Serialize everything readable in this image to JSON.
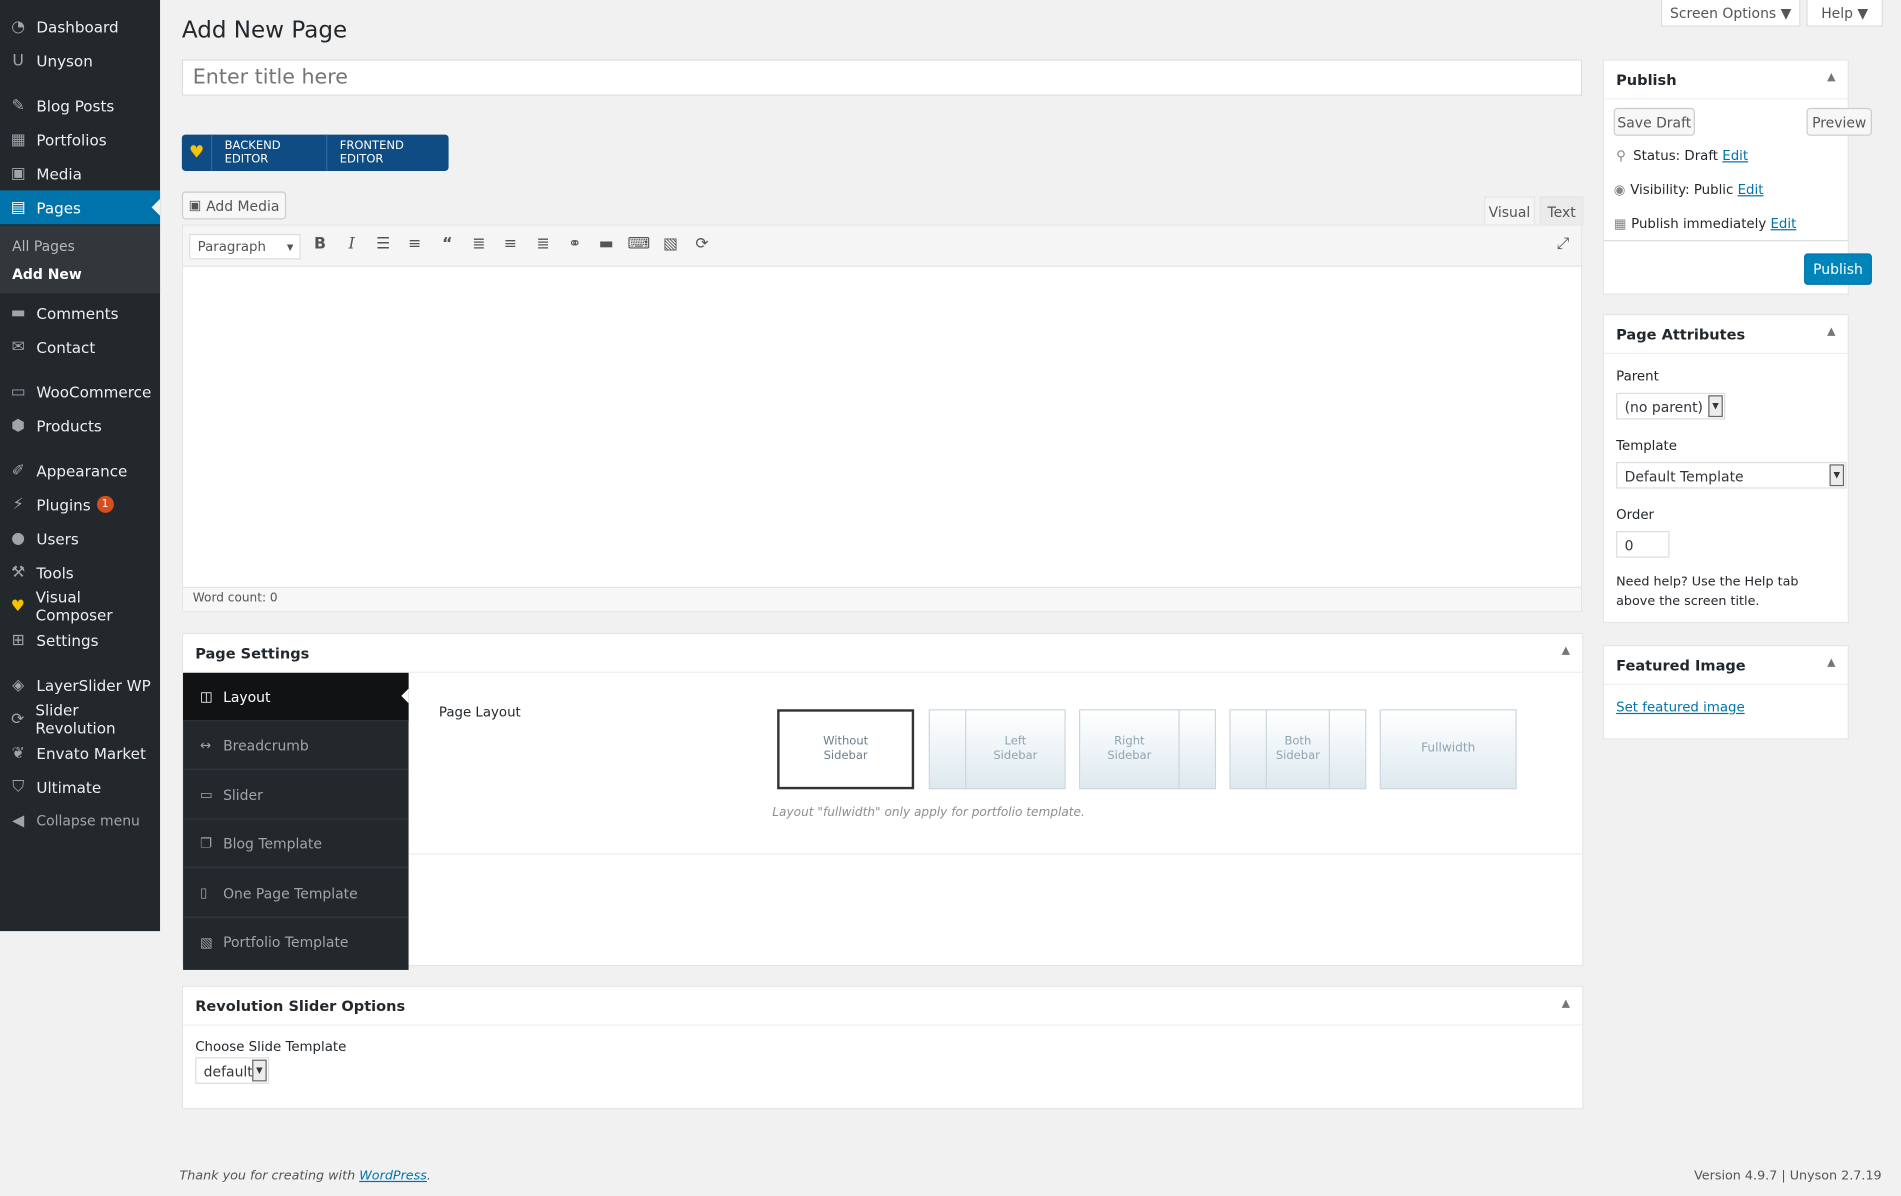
{
  "menu": {
    "items": [
      {
        "label": "Dashboard",
        "icon": "dashboard-icon",
        "glyph": "◔"
      },
      {
        "label": "Unyson",
        "icon": "unyson-icon",
        "glyph": "U"
      },
      {
        "label": "Blog Posts",
        "icon": "pin-icon",
        "glyph": "✎"
      },
      {
        "label": "Portfolios",
        "icon": "portfolio-icon",
        "glyph": "▦"
      },
      {
        "label": "Media",
        "icon": "media-icon",
        "glyph": "▣"
      },
      {
        "label": "Pages",
        "icon": "pages-icon",
        "glyph": "▤"
      },
      {
        "label": "Comments",
        "icon": "comments-icon",
        "glyph": "▬"
      },
      {
        "label": "Contact",
        "icon": "mail-icon",
        "glyph": "✉"
      },
      {
        "label": "WooCommerce",
        "icon": "woocommerce-icon",
        "glyph": "▭"
      },
      {
        "label": "Products",
        "icon": "products-icon",
        "glyph": "⬢"
      },
      {
        "label": "Appearance",
        "icon": "brush-icon",
        "glyph": "✐"
      },
      {
        "label": "Plugins",
        "icon": "plugin-icon",
        "glyph": "⚡"
      },
      {
        "label": "Users",
        "icon": "users-icon",
        "glyph": "●"
      },
      {
        "label": "Tools",
        "icon": "wrench-icon",
        "glyph": "⚒"
      },
      {
        "label": "Visual Composer",
        "icon": "visual-composer-icon",
        "glyph": "♥"
      },
      {
        "label": "Settings",
        "icon": "settings-icon",
        "glyph": "⊞"
      },
      {
        "label": "LayerSlider WP",
        "icon": "layerslider-icon",
        "glyph": "◈"
      },
      {
        "label": "Slider Revolution",
        "icon": "refresh-icon",
        "glyph": "⟳"
      },
      {
        "label": "Envato Market",
        "icon": "envato-icon",
        "glyph": "❦"
      },
      {
        "label": "Ultimate",
        "icon": "shield-icon",
        "glyph": "⛉"
      },
      {
        "label": "Collapse menu",
        "icon": "collapse-icon",
        "glyph": "◀"
      }
    ],
    "plugins_badge": "1",
    "sub": [
      "All Pages",
      "Add New"
    ]
  },
  "header": {
    "screen_options": "Screen Options ▼",
    "help": "Help ▼",
    "title": "Add New Page",
    "title_placeholder": "Enter title here"
  },
  "vc": {
    "backend": "BACKEND EDITOR",
    "frontend": "FRONTEND EDITOR"
  },
  "editor": {
    "add_media": "Add Media",
    "tab_visual": "Visual",
    "tab_text": "Text",
    "format": "Paragraph",
    "word_count": "Word count: 0"
  },
  "publish": {
    "title": "Publish",
    "save_draft": "Save Draft",
    "preview": "Preview",
    "status_label": "Status: ",
    "status": "Draft",
    "visibility_label": "Visibility: ",
    "visibility": "Public",
    "publish_label": "Publish ",
    "publish_when": "immediately",
    "edit": "Edit",
    "publish_btn": "Publish"
  },
  "attributes": {
    "title": "Page Attributes",
    "parent_label": "Parent",
    "parent": "(no parent)",
    "template_label": "Template",
    "template": "Default Template",
    "order_label": "Order",
    "order": "0",
    "help": "Need help? Use the Help tab above the screen title."
  },
  "featured": {
    "title": "Featured Image",
    "link": "Set featured image"
  },
  "settings": {
    "title": "Page Settings",
    "tabs": [
      "Layout",
      "Breadcrumb",
      "Slider",
      "Blog Template",
      "One Page Template",
      "Portfolio Template"
    ],
    "page_layout": "Page Layout",
    "layouts": [
      [
        "Without",
        "Sidebar"
      ],
      [
        "Left",
        "Sidebar"
      ],
      [
        "Right",
        "Sidebar"
      ],
      [
        "Both",
        "Sidebar"
      ],
      [
        "Fullwidth",
        ""
      ]
    ],
    "note": "Layout \"fullwidth\" only apply for portfolio template."
  },
  "revslider": {
    "title": "Revolution Slider Options",
    "label": "Choose Slide Template",
    "value": "default"
  },
  "footer": {
    "thanks": "Thank you for creating with ",
    "wp": "WordPress",
    "period": ".",
    "version": "Version 4.9.7 | Unyson 2.7.19"
  }
}
